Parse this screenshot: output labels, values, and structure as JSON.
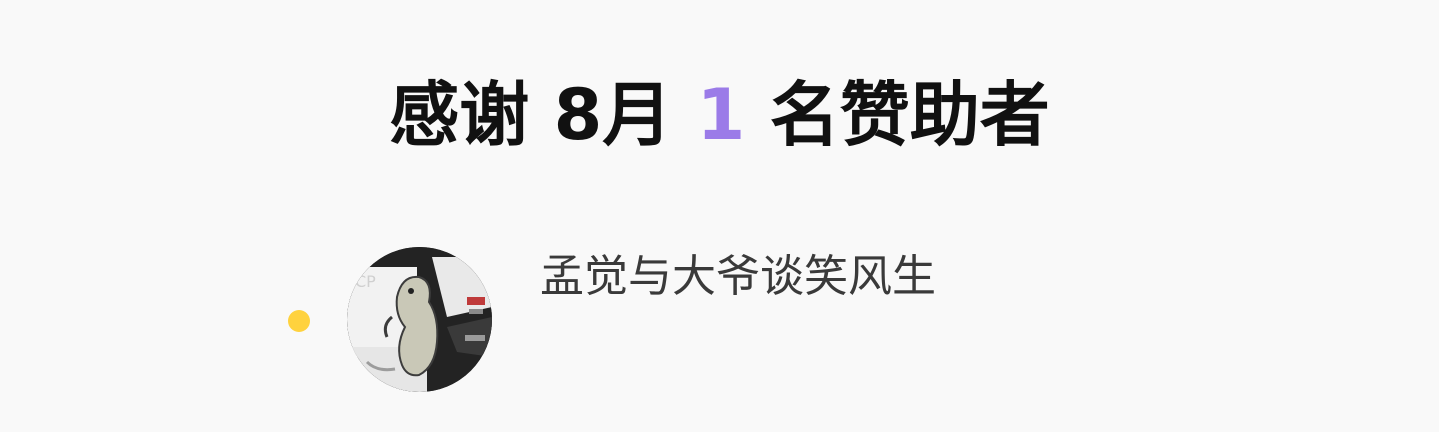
{
  "heading": {
    "prefix": "感谢 8月 ",
    "count": "1",
    "suffix": " 名赞助者"
  },
  "sponsors": [
    {
      "name": "孟觉与大爷谈笑风生",
      "avatar_icon": "lizard-avatar-icon"
    }
  ],
  "colors": {
    "background": "#f9f9f9",
    "count_accent": "#9b7be8",
    "dot": "#ffd23e",
    "text": "#111111"
  }
}
